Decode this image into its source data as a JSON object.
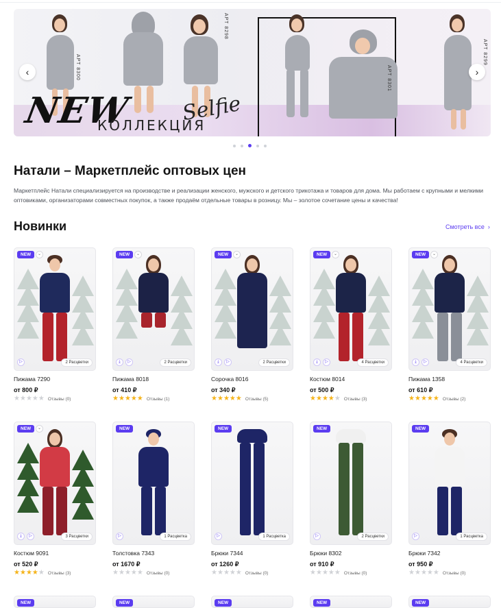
{
  "banner": {
    "headline": "NEW",
    "subline": "КОЛЛЕКЦИЯ",
    "script": "Selfie",
    "articles": [
      "АРТ 8300",
      "АРТ 8298",
      "АРТ 8301",
      "АРТ 8299"
    ],
    "slides_total": 5,
    "active_slide": 3,
    "prev_icon": "chevron-left-icon",
    "next_icon": "chevron-right-icon"
  },
  "page_title": "Натали – Маркетплейс оптовых цен",
  "intro": "Маркетплейс Натали специализируется на производстве и реализации женского, мужского и детского трикотажа и товаров для дома. Мы работаем с крупными и мелкими оптовиками, организаторами совместных покупок, а также продаём отдельные товары в розницу. Мы – золотое сочетание цены и качества!",
  "section": {
    "title": "Новинки",
    "see_all": "Смотреть все"
  },
  "colors": {
    "accent": "#5b3cf0",
    "star": "#f5b41b",
    "star_empty": "#d0d2d6"
  },
  "badge_label": "NEW",
  "products": [
    {
      "name": "Пижама 7290",
      "price": "от 800 ₽",
      "colors_label": "2 Расцветки",
      "stars": 0,
      "reviews": "Отзывы (0)",
      "extra_icon": false
    },
    {
      "name": "Пижама 8018",
      "price": "от 410 ₽",
      "colors_label": "2 Расцветки",
      "stars": 5,
      "reviews": "Отзывы (1)",
      "extra_icon": true
    },
    {
      "name": "Сорочка 8016",
      "price": "от 340 ₽",
      "colors_label": "2 Расцветки",
      "stars": 5,
      "reviews": "Отзывы (5)",
      "extra_icon": true
    },
    {
      "name": "Костюм 8014",
      "price": "от 500 ₽",
      "colors_label": "4 Расцветки",
      "stars": 4,
      "reviews": "Отзывы (3)",
      "extra_icon": true
    },
    {
      "name": "Пижама 1358",
      "price": "от 610 ₽",
      "colors_label": "4 Расцветки",
      "stars": 5,
      "reviews": "Отзывы (2)",
      "extra_icon": true
    },
    {
      "name": "Костюм 9091",
      "price": "от 520 ₽",
      "colors_label": "3 Расцветки",
      "stars": 4,
      "reviews": "Отзывы (3)",
      "extra_icon": true
    },
    {
      "name": "Толстовка 7343",
      "price": "от 1670 ₽",
      "colors_label": "1 Расцветка",
      "stars": 0,
      "reviews": "Отзывы (0)",
      "extra_icon": false
    },
    {
      "name": "Брюки 7344",
      "price": "от 1260 ₽",
      "colors_label": "1 Расцветка",
      "stars": 0,
      "reviews": "Отзывы (0)",
      "extra_icon": false
    },
    {
      "name": "Брюки 8302",
      "price": "от 910 ₽",
      "colors_label": "2 Расцветки",
      "stars": 0,
      "reviews": "Отзывы (0)",
      "extra_icon": false
    },
    {
      "name": "Брюки 7342",
      "price": "от 950 ₽",
      "colors_label": "1 Расцветка",
      "stars": 0,
      "reviews": "Отзывы (0)",
      "extra_icon": false
    }
  ]
}
